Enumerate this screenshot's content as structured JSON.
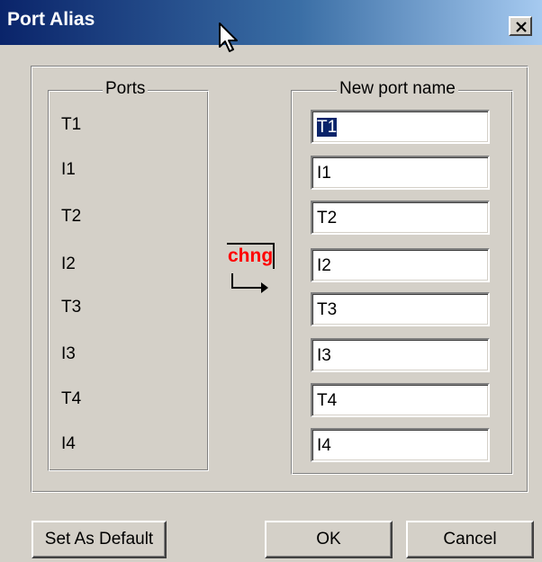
{
  "window": {
    "title": "Port Alias"
  },
  "ports_group": {
    "legend": "Ports",
    "items": [
      "T1",
      "I1",
      "T2",
      "I2",
      "T3",
      "I3",
      "T4",
      "I4"
    ]
  },
  "new_names_group": {
    "legend": "New port name",
    "values": [
      "T1",
      "I1",
      "T2",
      "I2",
      "T3",
      "I3",
      "T4",
      "I4"
    ]
  },
  "change_button": {
    "label": "chng"
  },
  "buttons": {
    "set_default": "Set As Default",
    "ok": "OK",
    "cancel": "Cancel"
  },
  "colors": {
    "title_gradient_start": "#0a246a",
    "title_gradient_end": "#a6caf0",
    "change_label": "#ff0000",
    "selection": "#0a246a",
    "face": "#d4d0c8"
  }
}
